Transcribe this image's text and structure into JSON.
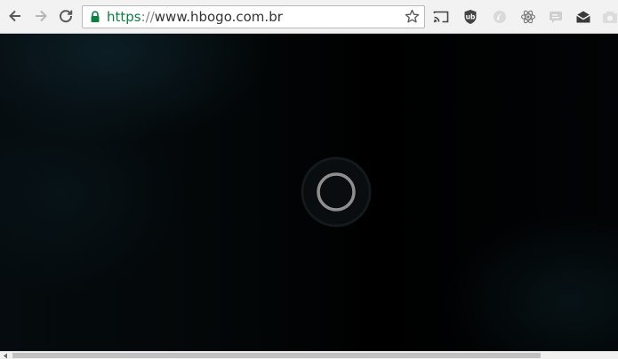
{
  "browser": {
    "back_icon": "arrow-left-icon",
    "forward_icon": "arrow-right-icon",
    "reload_icon": "reload-icon",
    "address_bar": {
      "secure_icon": "lock-icon",
      "url_scheme": "https",
      "url_separator": "://",
      "url_host": "www.hbogo.com.br",
      "bookmark_icon": "star-icon"
    },
    "extensions": [
      {
        "name": "cast-icon"
      },
      {
        "name": "ublock-icon"
      },
      {
        "name": "extension-swirl-icon"
      },
      {
        "name": "react-devtools-icon"
      },
      {
        "name": "extension-chat-icon"
      },
      {
        "name": "mail-icon"
      },
      {
        "name": "camera-icon"
      }
    ],
    "colors": {
      "secure_green": "#0b8043",
      "toolbar_bg": "#f2f2f2"
    }
  },
  "page": {
    "loading": true,
    "spinner_icon": "loading-spinner-icon"
  }
}
